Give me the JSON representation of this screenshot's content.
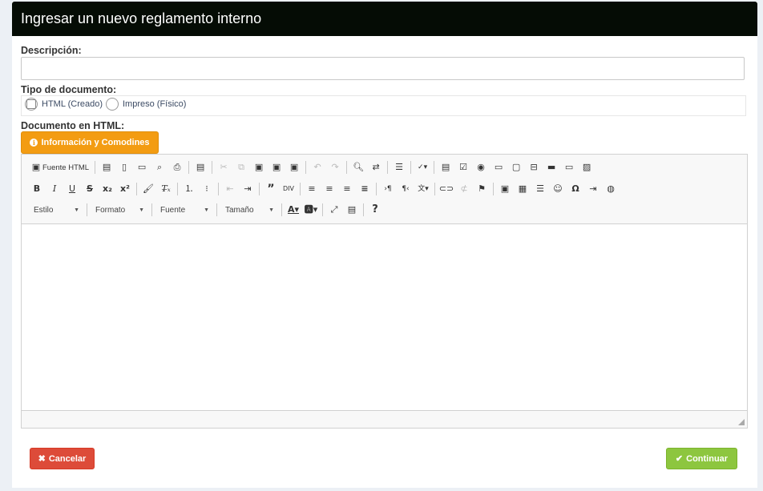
{
  "header": {
    "title": "Ingresar un nuevo reglamento interno"
  },
  "form": {
    "descripcion_label": "Descripción:",
    "descripcion_value": "",
    "tipo_label": "Tipo de documento:",
    "tipo_options": [
      {
        "label": "HTML (Creado)",
        "checked": false
      },
      {
        "label": "Impreso (Físico)",
        "checked": false
      }
    ],
    "documento_label": "Documento en HTML:",
    "info_button": "Información y Comodines"
  },
  "toolbar": {
    "source_label": "Fuente HTML",
    "selects": {
      "estilo": "Estilo",
      "formato": "Formato",
      "fuente": "Fuente",
      "tamano": "Tamaño"
    },
    "help": "?"
  },
  "actions": {
    "cancel": "Cancelar",
    "continue": "Continuar"
  },
  "colors": {
    "header_bg": "#050c05",
    "info_button": "#f39c12",
    "cancel_button": "#dd4b39",
    "continue_button": "#8dc63f"
  }
}
